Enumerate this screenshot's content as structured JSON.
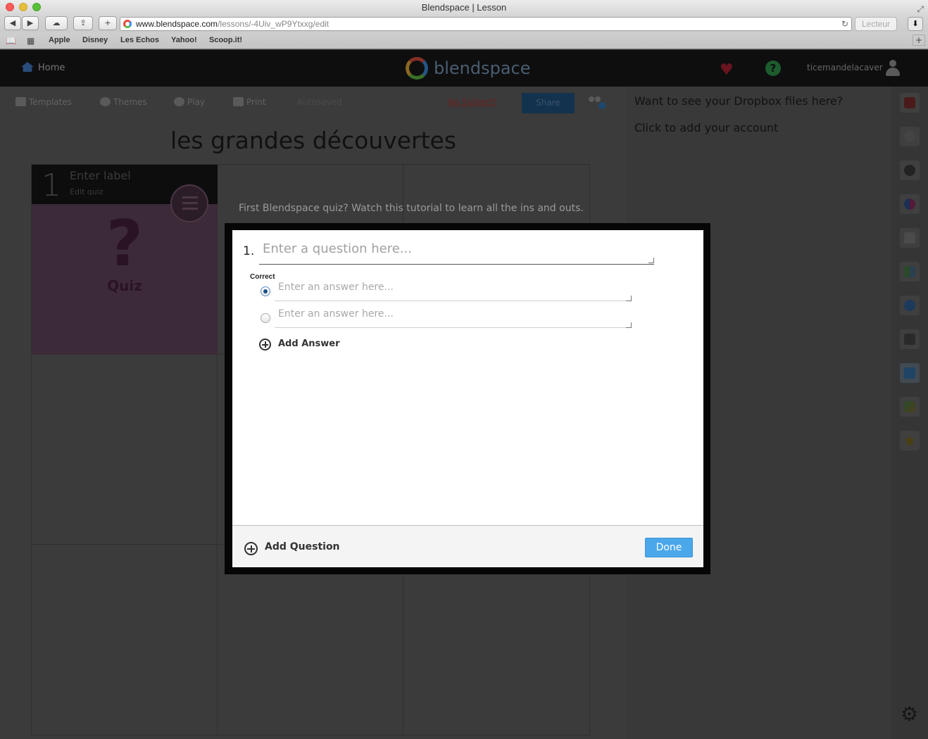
{
  "browser": {
    "window_title": "Blendspace | Lesson",
    "url_host": "www.blendspace.com",
    "url_path": "/lessons/-4Uiv_wP9Ytxxg/edit",
    "reader_label": "Lecteur",
    "bookmarks": [
      "Apple",
      "Disney",
      "Les Echos",
      "Yahoo!",
      "Scoop.it!"
    ]
  },
  "header": {
    "home_label": "Home",
    "logo_text": "blendspace",
    "username": "ticemandelacaver",
    "help_symbol": "?"
  },
  "editor_toolbar": {
    "templates_label": "Templates",
    "themes_label": "Themes",
    "play_label": "Play",
    "print_label": "Print",
    "autosaved_label": "Autosaved",
    "no_subject_label": "No Subject!",
    "share_label": "Share"
  },
  "lesson": {
    "title": "les grandes découvertes",
    "tutorial_hint": "First Blendspace quiz? Watch this tutorial to learn all the ins and outs."
  },
  "quiz_tile": {
    "number": "1",
    "label_placeholder": "Enter label",
    "edit_label": "Edit quiz",
    "symbol": "?",
    "type_label": "Quiz"
  },
  "side_panel": {
    "title": "Want to see your Dropbox files here?",
    "link": "Click to add your account"
  },
  "quiz_modal": {
    "question_number": "1.",
    "question_placeholder": "Enter a question here...",
    "correct_label": "Correct",
    "answers": [
      {
        "placeholder": "Enter an answer here...",
        "correct": true
      },
      {
        "placeholder": "Enter an answer here...",
        "correct": false
      }
    ],
    "add_answer_label": "Add Answer",
    "add_question_label": "Add Question",
    "done_label": "Done"
  },
  "rail_icons": [
    "youtube-icon",
    "google-icon",
    "educreations-icon",
    "flickr-icon",
    "gooru-icon",
    "bookshare-icon",
    "web-icon",
    "computer-icon",
    "dropbox-icon",
    "drive-icon",
    "favorites-icon"
  ],
  "colors": {
    "done_button": "#4aa7ea",
    "overlay_background": "#3b3b3b"
  }
}
